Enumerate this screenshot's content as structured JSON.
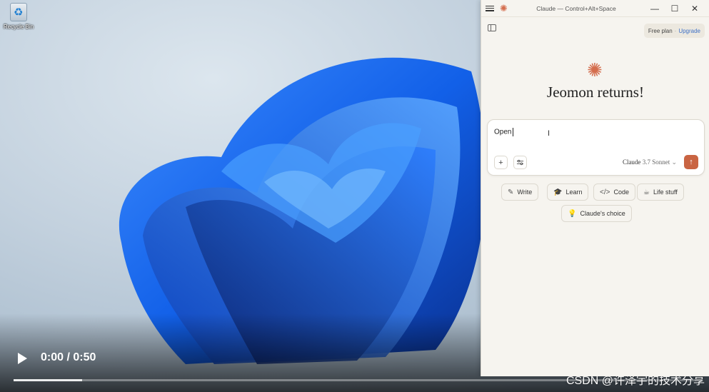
{
  "desktop": {
    "recycle_bin_label": "Recycle Bin"
  },
  "video": {
    "time": "0:00 / 0:50",
    "progress_fraction": 0.1,
    "watermark": "CSDN @许泽宇的技术分享"
  },
  "app": {
    "window_title": "Claude — Control+Alt+Space",
    "plan_label": "Free plan",
    "plan_separator": "·",
    "upgrade_label": "Upgrade",
    "greeting": "Jeomon returns!",
    "composer_text": "Open",
    "model_name": "Claude",
    "model_version": "3.7 Sonnet",
    "colors": {
      "accent": "#c96442",
      "brand_star": "#d46d4d",
      "upgrade": "#3f71c6"
    },
    "suggestions": [
      {
        "label": "Write",
        "icon": "pencil-icon"
      },
      {
        "label": "Learn",
        "icon": "graduation-cap-icon"
      },
      {
        "label": "Code",
        "icon": "code-icon"
      },
      {
        "label": "Life stuff",
        "icon": "coffee-cup-icon"
      },
      {
        "label": "Claude's choice",
        "icon": "lightbulb-icon"
      }
    ]
  }
}
